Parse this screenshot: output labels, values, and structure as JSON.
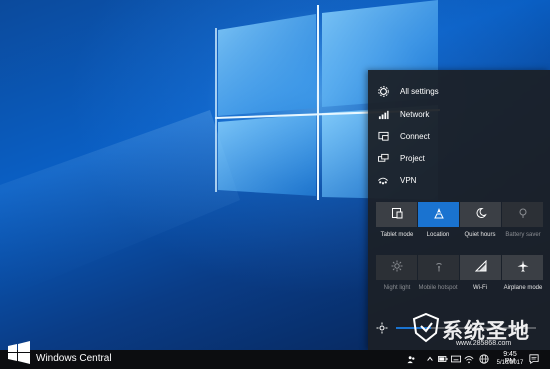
{
  "action_center": {
    "menu": [
      {
        "label": "All settings",
        "icon": "gear-icon"
      },
      {
        "label": "Network",
        "icon": "network-icon"
      },
      {
        "label": "Connect",
        "icon": "connect-icon"
      },
      {
        "label": "Project",
        "icon": "project-icon"
      },
      {
        "label": "VPN",
        "icon": "vpn-icon"
      }
    ],
    "tiles": [
      {
        "label": "Tablet mode",
        "icon": "tablet-mode-icon",
        "state": "off"
      },
      {
        "label": "Location",
        "icon": "location-icon",
        "state": "on"
      },
      {
        "label": "Quiet hours",
        "icon": "moon-icon",
        "state": "off"
      },
      {
        "label": "Battery saver",
        "icon": "battery-saver-icon",
        "state": "disabled"
      },
      {
        "label": "Night light",
        "icon": "night-light-icon",
        "state": "disabled"
      },
      {
        "label": "Mobile hotspot",
        "icon": "hotspot-icon",
        "state": "disabled"
      },
      {
        "label": "Wi-Fi",
        "icon": "wifi-icon",
        "state": "off"
      },
      {
        "label": "Airplane mode",
        "icon": "airplane-icon",
        "state": "off"
      }
    ],
    "brightness": {
      "icon": "brightness-icon",
      "level": 0.25
    }
  },
  "taskbar": {
    "brand": "Windows Central",
    "time": "9:45 PM",
    "date": "5/16/2017"
  },
  "watermark": {
    "title": "系统圣地",
    "url": "www.285868.com"
  },
  "colors": {
    "accent": "#1a73d0",
    "panel": "#1c2026",
    "taskbar": "#0c0d10"
  }
}
